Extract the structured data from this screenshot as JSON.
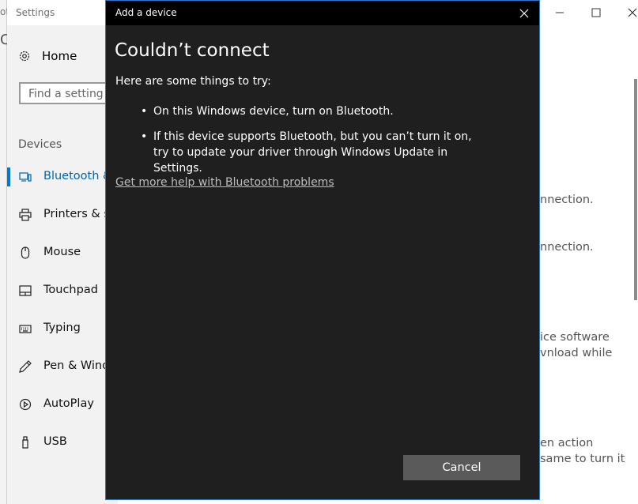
{
  "background_left_fragment": {
    "line1": "ot",
    "line2": "C"
  },
  "settings": {
    "title": "Settings",
    "home_label": "Home",
    "search_placeholder": "Find a setting",
    "section_header": "Devices",
    "nav_items": [
      {
        "label": "Bluetooth & other devices",
        "icon": "bluetooth-devices-icon",
        "active": true
      },
      {
        "label": "Printers & scanners",
        "icon": "printer-icon"
      },
      {
        "label": "Mouse",
        "icon": "mouse-icon"
      },
      {
        "label": "Touchpad",
        "icon": "touchpad-icon"
      },
      {
        "label": "Typing",
        "icon": "keyboard-icon"
      },
      {
        "label": "Pen & Windows Ink",
        "icon": "pen-icon"
      },
      {
        "label": "AutoPlay",
        "icon": "autoplay-icon"
      },
      {
        "label": "USB",
        "icon": "usb-icon"
      }
    ],
    "right_fragments": [
      "nnection.",
      "nnection.",
      "ice software",
      "vnload while",
      "en action",
      "same to turn it"
    ]
  },
  "dialog": {
    "title": "Add a device",
    "heading": "Couldn’t connect",
    "intro": "Here are some things to try:",
    "tips": [
      "On this Windows device, turn on Bluetooth.",
      "If this device supports Bluetooth, but you can’t turn it on, try to update your driver through Windows Update in Settings."
    ],
    "help_link": "Get more help with Bluetooth problems",
    "cancel_label": "Cancel"
  },
  "colors": {
    "accent": "#0078d7",
    "dialog_bg": "#1f1f1f",
    "dialog_border": "#2b79c5"
  }
}
